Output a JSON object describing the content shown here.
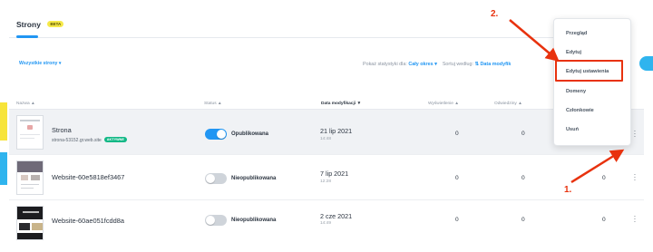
{
  "header": {
    "tab_label": "Strony",
    "beta_badge": "BETA"
  },
  "filters": {
    "all_sites": "Wszystkie strony ▾",
    "stats_label": "Pokaż statystyki dla:",
    "stats_value": "Cały okres ▾",
    "sort_label": "Sortuj według:",
    "sort_value": "⇅ Data modyfik"
  },
  "table": {
    "columns": {
      "name": "Nazwa ▲",
      "status": "Status ▲",
      "modified": "Data modyfikacji ▼",
      "views": "Wyświetlenie ▲",
      "visits": "Odwiedziny ▲"
    },
    "rows": [
      {
        "name": "Strona",
        "domain": "strona-53152.gr.web.site",
        "active_badge": "AKTYWNE",
        "status": "Opublikowana",
        "status_on": true,
        "date": "21 lip 2021",
        "time": "14:48",
        "views": "0",
        "visits": "0",
        "extra": "0"
      },
      {
        "name": "Website-60e5818ef3467",
        "status": "Nieopublikowana",
        "status_on": false,
        "date": "7 lip 2021",
        "time": "12:28",
        "views": "0",
        "visits": "0",
        "extra": "0"
      },
      {
        "name": "Website-60ae051fcdd8a",
        "status": "Nieopublikowana",
        "status_on": false,
        "date": "2 cze 2021",
        "time": "14:49",
        "views": "0",
        "visits": "0",
        "extra": "0"
      }
    ]
  },
  "menu": {
    "items": [
      "Przegląd",
      "Edytuj",
      "Edytuj ustawienia",
      "Domeny",
      "Członkowie",
      "Usuń"
    ]
  },
  "annotations": {
    "step1": "1.",
    "step2": "2."
  },
  "colors": {
    "accent": "#2196f3",
    "highlight": "#e8320e",
    "active": "#12b886",
    "beta": "#f6e94a"
  },
  "icons": [
    "kebab-menu-icon",
    "chevron-down-icon",
    "sort-icon"
  ]
}
